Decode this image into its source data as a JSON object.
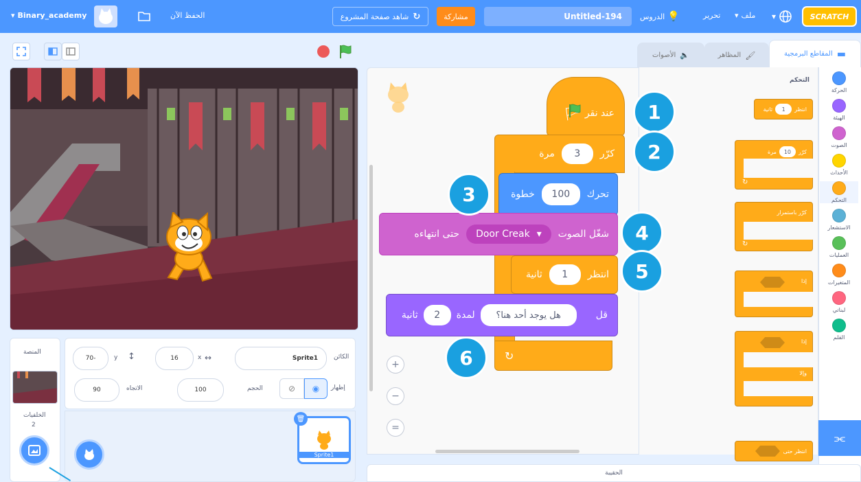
{
  "menu": {
    "logo": "SCRATCH",
    "file": "ملف",
    "edit": "تحرير",
    "tutorials": "الدروس",
    "project_title": "Untitled-194",
    "share": "مشاركة",
    "see_project": "شاهد صفحة المشروع",
    "save_now": "الحفظ الآن",
    "username": "Binary_academy"
  },
  "tabs": {
    "code": "المقاطع البرمجية",
    "costumes": "المظاهر",
    "sounds": "الأصوات"
  },
  "categories": [
    {
      "label": "الحركة",
      "color": "#4c97ff"
    },
    {
      "label": "الهيئة",
      "color": "#9966ff"
    },
    {
      "label": "الصوت",
      "color": "#cf63cf"
    },
    {
      "label": "الأحداث",
      "color": "#ffd500"
    },
    {
      "label": "التحكم",
      "color": "#ffab19"
    },
    {
      "label": "الاستشعار",
      "color": "#5cb1d6"
    },
    {
      "label": "العمليات",
      "color": "#59c059"
    },
    {
      "label": "المتغيرات",
      "color": "#ff8c1a"
    },
    {
      "label": "لبناتي",
      "color": "#ff6680"
    },
    {
      "label": "القلم",
      "color": "#0fbd8c"
    }
  ],
  "palette": {
    "heading": "التحكم",
    "wait": "انتظر",
    "wait_value": "1",
    "wait_unit": "ثانية",
    "repeat": "كرّر",
    "repeat_value": "10",
    "repeat_unit": "مرة",
    "forever": "كرّر باستمرار",
    "if": "إذا",
    "else": "وإلا",
    "wait_until": "انتظر حتى"
  },
  "script": {
    "hat": "عند نقر",
    "repeat_label": "كرّر",
    "repeat_value": "3",
    "repeat_unit": "مرة",
    "move_label": "تحرك",
    "move_value": "100",
    "move_unit": "خطوة",
    "sound_label": "شغّل الصوت",
    "sound_value": "Door Creak",
    "sound_until": "حتى انتهاءه",
    "wait_label": "انتظر",
    "wait_value": "1",
    "wait_unit": "ثانية",
    "say_label": "قل",
    "say_value": "هل يوجد أحد هنا؟",
    "say_for": "لمدة",
    "say_secs": "2",
    "say_unit": "ثانية",
    "repeat_arrow": "↻"
  },
  "callouts": [
    "1",
    "2",
    "3",
    "4",
    "5",
    "6"
  ],
  "sprite_info": {
    "sprite_label": "الكائن",
    "sprite_name": "Sprite1",
    "x_label": "x",
    "x_value": "16",
    "y_label": "y",
    "y_value": "70-",
    "show_label": "إظهار",
    "size_label": "الحجم",
    "size_value": "100",
    "direction_label": "الاتجاه",
    "direction_value": "90"
  },
  "sprite_list": [
    {
      "name": "Sprite1"
    }
  ],
  "stage_panel": {
    "title": "المنصة",
    "backdrops_label": "الخلفيات",
    "backdrops_count": "2"
  },
  "backpack": "الحقيبة",
  "zoom": {
    "in": "+",
    "out": "−",
    "reset": "="
  }
}
